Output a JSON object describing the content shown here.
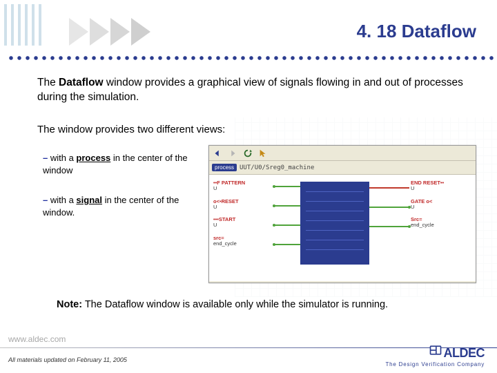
{
  "title": "4. 18  Dataflow",
  "intro_pre": "The ",
  "intro_bold": "Dataflow",
  "intro_post": " window provides a graphical view of signals flowing in and out of processes during the simulation.",
  "views_line": "The window provides two different views:",
  "bullets": [
    {
      "pre": "with a ",
      "bold": "process",
      "post": " in the center of the window"
    },
    {
      "pre": "with a ",
      "bold": "signal",
      "post": " in the center of the window."
    }
  ],
  "note_bold": "Note:",
  "note_text": " The Dataflow window is available only while the simulator is running.",
  "footer": {
    "url": "www.aldec.com",
    "updated": "All materials updated on  February 11, 2005",
    "brand": "ALDEC",
    "tagline": "The Design Verification Company"
  },
  "window": {
    "chip": "process",
    "path": "UUT/U0/Sreg0_machine",
    "left_signals": [
      {
        "label": "••F PATTERN",
        "value": "U"
      },
      {
        "label": "o<•RESET",
        "value": "U"
      },
      {
        "label": "•••START",
        "value": "U"
      },
      {
        "label": "src=",
        "value": "end_cycle"
      }
    ],
    "right_signals": [
      {
        "label": "END RESET••",
        "value": "U"
      },
      {
        "label": "GATE o<",
        "value": "U"
      },
      {
        "label": "Src=",
        "value": "end_cycle"
      }
    ]
  }
}
